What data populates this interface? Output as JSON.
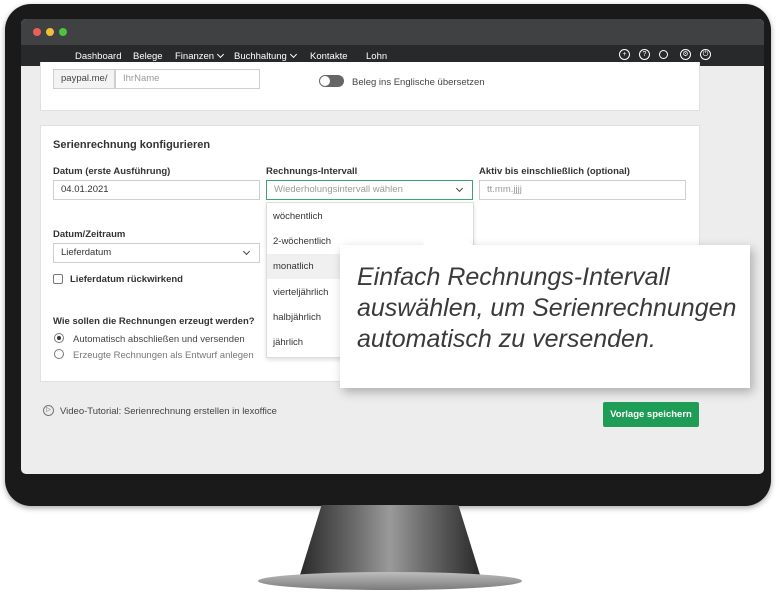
{
  "nav": {
    "items": [
      "Dashboard",
      "Belege",
      "Finanzen",
      "Buchhaltung",
      "Kontakte",
      "Lohn"
    ]
  },
  "top_card": {
    "paypal_prefix": "paypal.me/",
    "paypal_placeholder": "IhrName",
    "toggle_label": "Beleg ins Englische übersetzen"
  },
  "serien": {
    "title": "Serienrechnung konfigurieren",
    "datum_label": "Datum (erste Ausführung)",
    "datum_value": "04.01.2021",
    "intervall_label": "Rechnungs-Intervall",
    "intervall_placeholder": "Wiederholungsintervall wählen",
    "aktiv_label": "Aktiv bis einschließlich (optional)",
    "aktiv_placeholder": "tt.mm.jjjj",
    "zeitraum_label": "Datum/Zeitraum",
    "zeitraum_value": "Lieferdatum",
    "checkbox_label": "Lieferdatum rückwirkend",
    "question": "Wie sollen die Rechnungen erzeugt werden?",
    "option_1": "Automatisch abschließen und versenden",
    "option_2": "Erzeugte Rechnungen als Entwurf anlegen"
  },
  "dropdown": {
    "options": [
      "wöchentlich",
      "2-wöchentlich",
      "monatlich",
      "vierteljährlich",
      "halbjährlich",
      "jährlich"
    ]
  },
  "callout": {
    "line1": "Einfach Rechnungs-Intervall",
    "line2": "auswählen, um Serienrechnungen",
    "line3": "automatisch zu versenden."
  },
  "footer": {
    "tutorial_link": "Video-Tutorial: Serienrechnung erstellen in lexoffice",
    "save_button": "Vorlage speichern"
  },
  "colors": {
    "accent_green": "#1f9d57",
    "nav_bg": "#27292b"
  }
}
